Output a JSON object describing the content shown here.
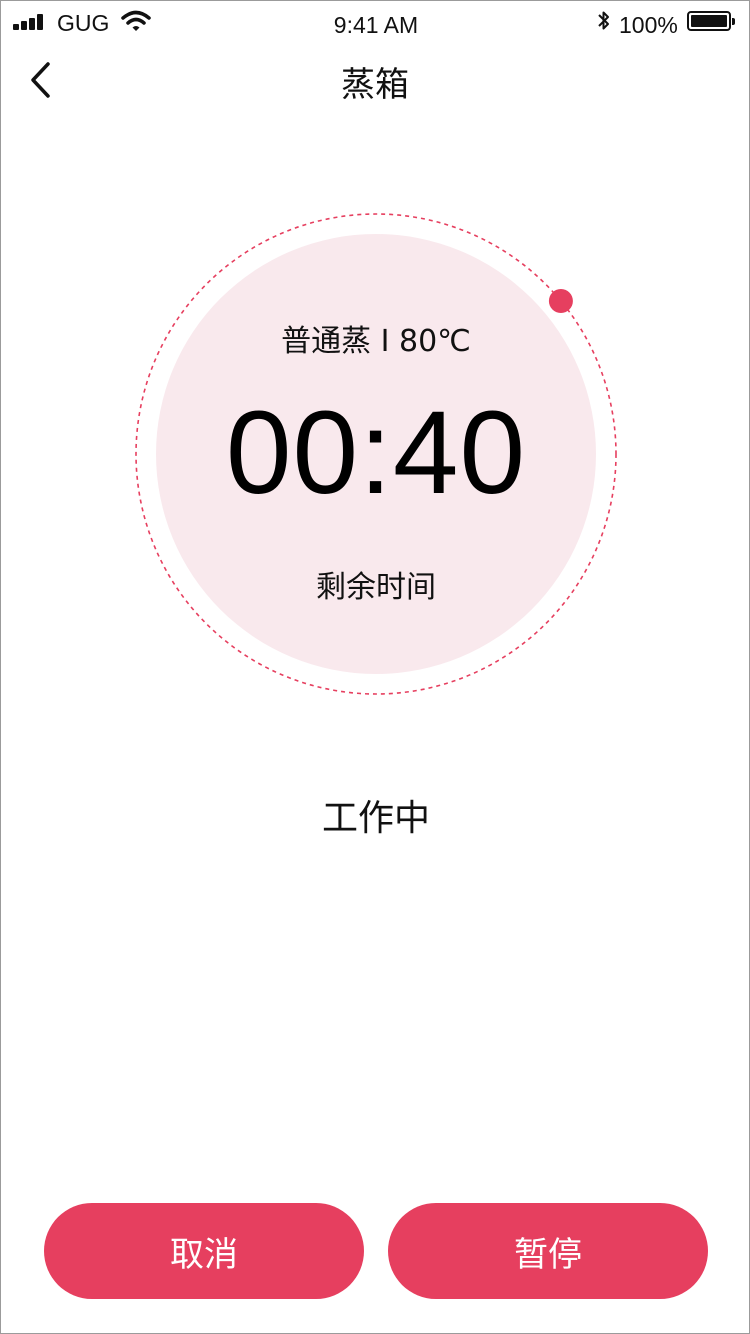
{
  "status_bar": {
    "carrier": "GUG",
    "time": "9:41 AM",
    "battery": "100%"
  },
  "nav": {
    "title": "蒸箱"
  },
  "timer": {
    "mode": "普通蒸 I 80℃",
    "time": "00:40",
    "label": "剩余时间",
    "progress": 0.14
  },
  "status": "工作中",
  "buttons": {
    "cancel": "取消",
    "pause": "暂停"
  },
  "colors": {
    "accent": "#e63f5f",
    "dial_fill": "#f9e9ed"
  }
}
